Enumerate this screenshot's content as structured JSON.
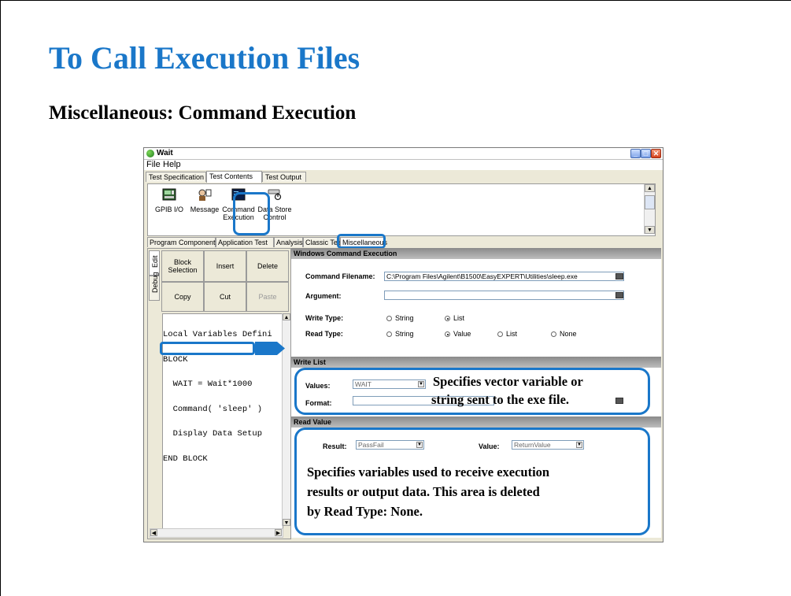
{
  "slide": {
    "title": "To Call Execution Files",
    "subtitle": "Miscellaneous: Command Execution"
  },
  "window": {
    "title": "Wait",
    "menu": [
      "File",
      "Help"
    ],
    "tabs": [
      "Test Specification",
      "Test Contents",
      "Test Output"
    ],
    "active_tab": "Test Contents"
  },
  "palette": {
    "items": [
      {
        "line1": "GPIB I/O",
        "line2": "",
        "icon": "gpib-icon"
      },
      {
        "line1": "Message",
        "line2": "",
        "icon": "message-icon"
      },
      {
        "line1": "Command",
        "line2": "Execution",
        "icon": "command-execution-icon"
      },
      {
        "line1": "Data Store",
        "line2": "Control",
        "icon": "data-store-icon"
      }
    ]
  },
  "subtabs": {
    "items": [
      "Program Component",
      "Application Test",
      "Analysis",
      "Classic Test",
      "Miscellaneous"
    ],
    "active": "Miscellaneous"
  },
  "left_panel": {
    "vtabs": [
      "Edit",
      "Debug"
    ],
    "buttons": {
      "block_selection_1": "Block",
      "block_selection_2": "Selection",
      "insert": "Insert",
      "delete": "Delete",
      "copy": "Copy",
      "cut": "Cut",
      "paste": "Paste"
    },
    "code_lines": [
      "Local Variables Defini",
      "BLOCK",
      "  WAIT = Wait*1000",
      "  Command( 'sleep' )",
      "  Display Data Setup",
      "END BLOCK"
    ]
  },
  "right_panel": {
    "sections": {
      "command": "Windows Command Execution",
      "write_list": "Write List",
      "read_value": "Read Value"
    },
    "command_filename_label": "Command Filename:",
    "command_filename_value": "C:\\Program Files\\Agilent\\B1500\\EasyEXPERT\\Utilities\\sleep.exe",
    "argument_label": "Argument:",
    "argument_value": "",
    "write_type_label": "Write Type:",
    "write_type_options": [
      "String",
      "List"
    ],
    "write_type_selected": "List",
    "read_type_label": "Read Type:",
    "read_type_options": [
      "String",
      "Value",
      "List",
      "None"
    ],
    "read_type_selected": "Value",
    "values_label": "Values:",
    "values_value": "WAIT",
    "format_label": "Format:",
    "format_value": "",
    "result_label": "Result:",
    "result_value": "PassFail",
    "value_label": "Value:",
    "value_value": "ReturnValue"
  },
  "callouts": {
    "write_line1": "Specifies vector variable  or",
    "write_line2": "string sent to the exe file.",
    "read_line1": "Specifies variables used to receive execution",
    "read_line2": "results or output data.  This area is deleted",
    "read_line3": "by Read Type: None."
  },
  "colors": {
    "title": "#1a77c9",
    "highlight": "#1a77c9"
  }
}
